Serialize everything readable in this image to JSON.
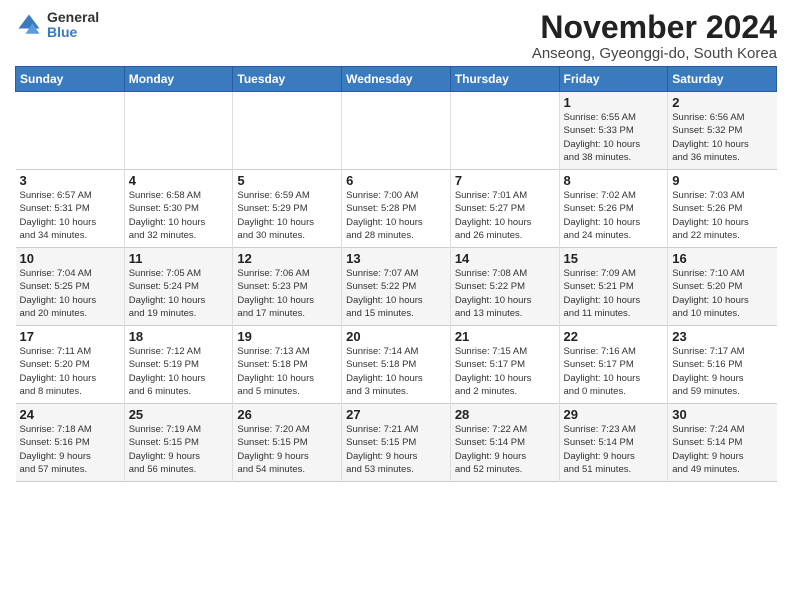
{
  "logo": {
    "general": "General",
    "blue": "Blue"
  },
  "title": "November 2024",
  "subtitle": "Anseong, Gyeonggi-do, South Korea",
  "headers": [
    "Sunday",
    "Monday",
    "Tuesday",
    "Wednesday",
    "Thursday",
    "Friday",
    "Saturday"
  ],
  "weeks": [
    [
      {
        "day": "",
        "info": ""
      },
      {
        "day": "",
        "info": ""
      },
      {
        "day": "",
        "info": ""
      },
      {
        "day": "",
        "info": ""
      },
      {
        "day": "",
        "info": ""
      },
      {
        "day": "1",
        "info": "Sunrise: 6:55 AM\nSunset: 5:33 PM\nDaylight: 10 hours\nand 38 minutes."
      },
      {
        "day": "2",
        "info": "Sunrise: 6:56 AM\nSunset: 5:32 PM\nDaylight: 10 hours\nand 36 minutes."
      }
    ],
    [
      {
        "day": "3",
        "info": "Sunrise: 6:57 AM\nSunset: 5:31 PM\nDaylight: 10 hours\nand 34 minutes."
      },
      {
        "day": "4",
        "info": "Sunrise: 6:58 AM\nSunset: 5:30 PM\nDaylight: 10 hours\nand 32 minutes."
      },
      {
        "day": "5",
        "info": "Sunrise: 6:59 AM\nSunset: 5:29 PM\nDaylight: 10 hours\nand 30 minutes."
      },
      {
        "day": "6",
        "info": "Sunrise: 7:00 AM\nSunset: 5:28 PM\nDaylight: 10 hours\nand 28 minutes."
      },
      {
        "day": "7",
        "info": "Sunrise: 7:01 AM\nSunset: 5:27 PM\nDaylight: 10 hours\nand 26 minutes."
      },
      {
        "day": "8",
        "info": "Sunrise: 7:02 AM\nSunset: 5:26 PM\nDaylight: 10 hours\nand 24 minutes."
      },
      {
        "day": "9",
        "info": "Sunrise: 7:03 AM\nSunset: 5:26 PM\nDaylight: 10 hours\nand 22 minutes."
      }
    ],
    [
      {
        "day": "10",
        "info": "Sunrise: 7:04 AM\nSunset: 5:25 PM\nDaylight: 10 hours\nand 20 minutes."
      },
      {
        "day": "11",
        "info": "Sunrise: 7:05 AM\nSunset: 5:24 PM\nDaylight: 10 hours\nand 19 minutes."
      },
      {
        "day": "12",
        "info": "Sunrise: 7:06 AM\nSunset: 5:23 PM\nDaylight: 10 hours\nand 17 minutes."
      },
      {
        "day": "13",
        "info": "Sunrise: 7:07 AM\nSunset: 5:22 PM\nDaylight: 10 hours\nand 15 minutes."
      },
      {
        "day": "14",
        "info": "Sunrise: 7:08 AM\nSunset: 5:22 PM\nDaylight: 10 hours\nand 13 minutes."
      },
      {
        "day": "15",
        "info": "Sunrise: 7:09 AM\nSunset: 5:21 PM\nDaylight: 10 hours\nand 11 minutes."
      },
      {
        "day": "16",
        "info": "Sunrise: 7:10 AM\nSunset: 5:20 PM\nDaylight: 10 hours\nand 10 minutes."
      }
    ],
    [
      {
        "day": "17",
        "info": "Sunrise: 7:11 AM\nSunset: 5:20 PM\nDaylight: 10 hours\nand 8 minutes."
      },
      {
        "day": "18",
        "info": "Sunrise: 7:12 AM\nSunset: 5:19 PM\nDaylight: 10 hours\nand 6 minutes."
      },
      {
        "day": "19",
        "info": "Sunrise: 7:13 AM\nSunset: 5:18 PM\nDaylight: 10 hours\nand 5 minutes."
      },
      {
        "day": "20",
        "info": "Sunrise: 7:14 AM\nSunset: 5:18 PM\nDaylight: 10 hours\nand 3 minutes."
      },
      {
        "day": "21",
        "info": "Sunrise: 7:15 AM\nSunset: 5:17 PM\nDaylight: 10 hours\nand 2 minutes."
      },
      {
        "day": "22",
        "info": "Sunrise: 7:16 AM\nSunset: 5:17 PM\nDaylight: 10 hours\nand 0 minutes."
      },
      {
        "day": "23",
        "info": "Sunrise: 7:17 AM\nSunset: 5:16 PM\nDaylight: 9 hours\nand 59 minutes."
      }
    ],
    [
      {
        "day": "24",
        "info": "Sunrise: 7:18 AM\nSunset: 5:16 PM\nDaylight: 9 hours\nand 57 minutes."
      },
      {
        "day": "25",
        "info": "Sunrise: 7:19 AM\nSunset: 5:15 PM\nDaylight: 9 hours\nand 56 minutes."
      },
      {
        "day": "26",
        "info": "Sunrise: 7:20 AM\nSunset: 5:15 PM\nDaylight: 9 hours\nand 54 minutes."
      },
      {
        "day": "27",
        "info": "Sunrise: 7:21 AM\nSunset: 5:15 PM\nDaylight: 9 hours\nand 53 minutes."
      },
      {
        "day": "28",
        "info": "Sunrise: 7:22 AM\nSunset: 5:14 PM\nDaylight: 9 hours\nand 52 minutes."
      },
      {
        "day": "29",
        "info": "Sunrise: 7:23 AM\nSunset: 5:14 PM\nDaylight: 9 hours\nand 51 minutes."
      },
      {
        "day": "30",
        "info": "Sunrise: 7:24 AM\nSunset: 5:14 PM\nDaylight: 9 hours\nand 49 minutes."
      }
    ]
  ]
}
